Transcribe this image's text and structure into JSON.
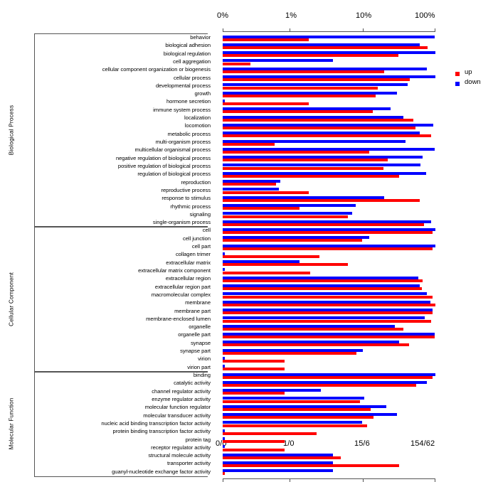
{
  "legend": {
    "position": "right",
    "entries": [
      {
        "label": "up",
        "color": "#ff0000"
      },
      {
        "label": "down",
        "color": "#0000ff"
      }
    ]
  },
  "groups": [
    {
      "name": "Biological Process"
    },
    {
      "name": "Cellular Component"
    },
    {
      "name": "Molecular Function"
    }
  ],
  "axes": {
    "top_label": "percent-of-genes",
    "top_ticks": [
      "0%",
      "1%",
      "10%",
      "100%"
    ],
    "bottom_ticks": [
      "0/0",
      "1/0",
      "15/6",
      "154/62"
    ]
  },
  "chart_data": {
    "type": "bar",
    "title": "",
    "xlabel": "",
    "ylabel": "",
    "orientation": "horizontal",
    "scale": "log-like",
    "grid": false,
    "legend_position": "right",
    "top_axis_ticks": [
      {
        "label": "0%",
        "pos": 0.0
      },
      {
        "label": "1%",
        "pos": 0.3143
      },
      {
        "label": "10%",
        "pos": 0.659
      },
      {
        "label": "100%",
        "pos": 1.0
      }
    ],
    "bottom_axis_ticks": [
      {
        "label": "0/0",
        "pos": 0.0
      },
      {
        "label": "1/0",
        "pos": 0.3143
      },
      {
        "label": "15/6",
        "pos": 0.659
      },
      {
        "label": "154/62",
        "pos": 1.0
      }
    ],
    "series": [
      {
        "name": "up",
        "color": "#ff0000"
      },
      {
        "name": "down",
        "color": "#0000ff"
      }
    ],
    "groups": [
      {
        "name": "Biological Process",
        "categories": [
          "behavior",
          "biological adhesion",
          "biological regulation",
          "cell aggregation",
          "cellular component organization or biogenesis",
          "cellular process",
          "developmental process",
          "growth",
          "hormone secretion",
          "immune system process",
          "localization",
          "locomotion",
          "metabolic process",
          "multi-organism process",
          "multicellular organismal process",
          "negative regulation of biological process",
          "positive regulation of biological process",
          "regulation of biological process",
          "reproduction",
          "reproductive process",
          "response to stimulus",
          "rhythmic process",
          "signaling",
          "single-organism process"
        ],
        "up": [
          0.405,
          0.963,
          0.825,
          0.13,
          0.76,
          0.88,
          0.73,
          0.72,
          0.405,
          0.705,
          0.895,
          0.905,
          0.98,
          0.245,
          0.69,
          0.775,
          0.755,
          0.83,
          0.25,
          0.405,
          0.925,
          0.36,
          0.59,
          0.945
        ],
        "down": [
          0.995,
          0.925,
          1.0,
          0.52,
          0.96,
          1.0,
          0.87,
          0.82,
          0.01,
          0.79,
          0.85,
          0.99,
          0.925,
          0.86,
          0.995,
          0.94,
          0.93,
          0.955,
          0.27,
          0.265,
          0.76,
          0.625,
          0.61,
          0.98
        ]
      },
      {
        "name": "Cellular Component",
        "categories": [
          "cell",
          "cell junction",
          "cell part",
          "collagen trimer",
          "extracellular matrix",
          "extracellular matrix component",
          "extracellular region",
          "extracellular region part",
          "macromolecular complex",
          "membrane",
          "membrane part",
          "membrane-enclosed lumen",
          "organelle",
          "organelle part",
          "synapse",
          "synapse part",
          "virion",
          "virion part"
        ],
        "up": [
          0.985,
          0.655,
          0.985,
          0.455,
          0.59,
          0.41,
          0.94,
          0.935,
          0.985,
          1.0,
          0.985,
          0.98,
          0.85,
          0.995,
          0.875,
          0.63,
          0.29,
          0.29
        ],
        "down": [
          1.0,
          0.69,
          1.0,
          0.01,
          0.36,
          0.01,
          0.92,
          0.925,
          0.96,
          0.975,
          0.985,
          0.95,
          0.81,
          0.995,
          0.83,
          0.66,
          0.01,
          0.01
        ]
      },
      {
        "name": "Molecular Function",
        "categories": [
          "binding",
          "catalytic activity",
          "channel regulator activity",
          "enzyme regulator activity",
          "molecular function regulator",
          "molecular transducer activity",
          "nucleic acid binding transcription factor activity",
          "protein binding transcription factor activity",
          "protein tag",
          "receptor regulator activity",
          "structural molecule activity",
          "transporter activity",
          "guanyl-nucleotide exchange factor activity"
        ],
        "up": [
          0.985,
          0.91,
          0.29,
          0.645,
          0.695,
          0.71,
          0.68,
          0.44,
          0.29,
          0.29,
          0.555,
          0.83,
          0.01
        ],
        "down": [
          1.0,
          0.96,
          0.46,
          0.665,
          0.77,
          0.82,
          0.655,
          0.01,
          0.01,
          0.01,
          0.52,
          0.52,
          0.52
        ]
      }
    ]
  }
}
